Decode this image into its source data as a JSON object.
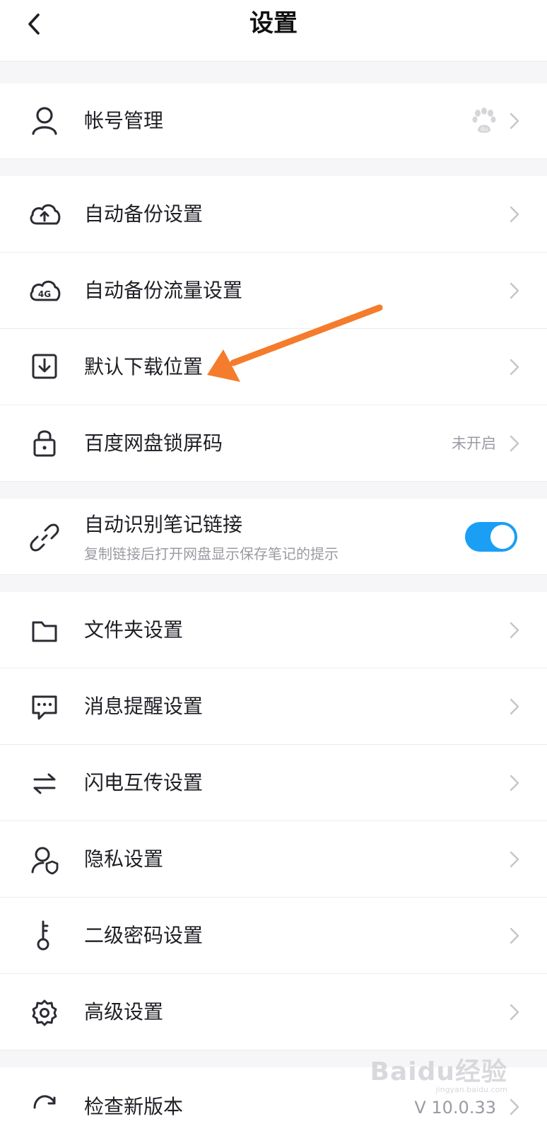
{
  "header": {
    "title": "设置"
  },
  "account": {
    "label": "帐号管理",
    "badge_icon": "baidu-paw-icon"
  },
  "backup": [
    {
      "label": "自动备份设置",
      "icon": "cloud-upload-icon"
    },
    {
      "label": "自动备份流量设置",
      "icon": "cloud-4g-icon",
      "icon_text": "4G"
    },
    {
      "label": "默认下载位置",
      "icon": "download-box-icon"
    },
    {
      "label": "百度网盘锁屏码",
      "icon": "lock-icon",
      "value": "未开启"
    }
  ],
  "note_link": {
    "label": "自动识别笔记链接",
    "desc": "复制链接后打开网盘显示保存笔记的提示",
    "enabled": true,
    "icon": "link-icon"
  },
  "more": [
    {
      "label": "文件夹设置",
      "icon": "folder-icon"
    },
    {
      "label": "消息提醒设置",
      "icon": "message-icon"
    },
    {
      "label": "闪电互传设置",
      "icon": "transfer-icon"
    },
    {
      "label": "隐私设置",
      "icon": "privacy-icon"
    },
    {
      "label": "二级密码设置",
      "icon": "key-icon"
    },
    {
      "label": "高级设置",
      "icon": "gear-icon"
    }
  ],
  "update": {
    "label": "检查新版本",
    "version": "V 10.0.33",
    "icon": "refresh-icon"
  },
  "annotation": {
    "color": "#f47c2c"
  },
  "watermark": {
    "text": "Baidu经验",
    "url": "jingyan.baidu.com"
  },
  "colors": {
    "accent": "#1a9ff5",
    "background": "#f6f6f8",
    "divider": "#ededf0"
  }
}
